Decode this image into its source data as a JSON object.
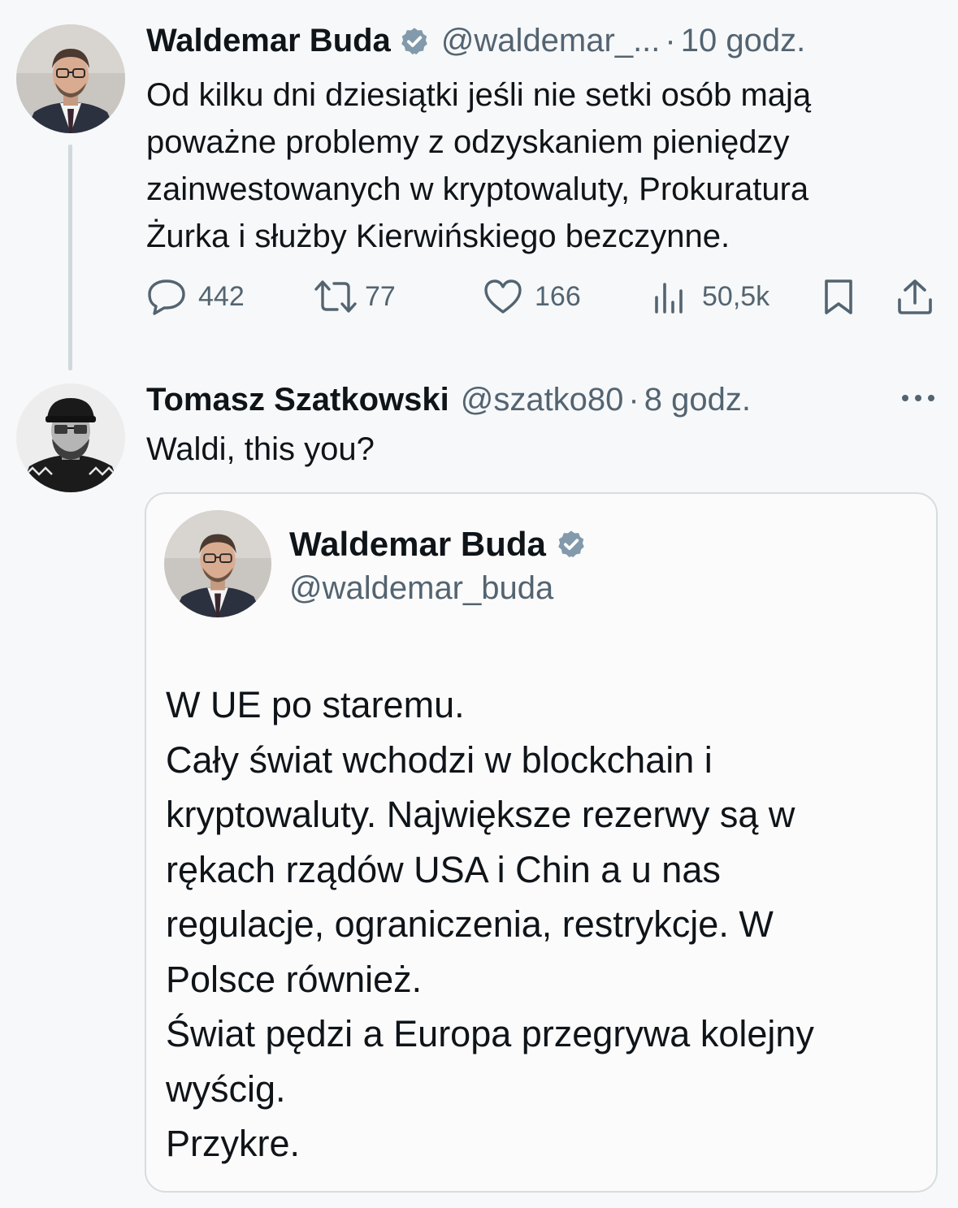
{
  "thread": {
    "original_tweet": {
      "author_name": "Waldemar Buda",
      "handle": "@waldemar_...",
      "separator": "·",
      "time": "10 godz.",
      "text": "Od kilku dni dziesiątki jeśli nie setki osób mają\npoważne problemy z odzyskaniem pieniędzy\nzainwestowanych w kryptowaluty, Prokuratura\nŻurka i służby Kierwińskiego bezczynne.",
      "icons": {
        "verified": "verified-badge-icon",
        "reply": "reply-icon",
        "retweet": "retweet-icon",
        "like": "heart-icon",
        "views": "views-icon",
        "bookmark": "bookmark-icon",
        "share": "share-icon"
      },
      "stats": {
        "replies": "442",
        "retweets": "77",
        "likes": "166",
        "views": "50,5k"
      }
    },
    "reply_tweet": {
      "author_name": "Tomasz Szatkowski",
      "handle": "@szatko80",
      "separator": "·",
      "time": "8 godz.",
      "text": "Waldi, this you?",
      "more_icon": "more-options-icon",
      "quoted_tweet": {
        "author_name": "Waldemar Buda",
        "handle": "@waldemar_buda",
        "text": "W UE po staremu.\nCały świat wchodzi w blockchain i\nkryptowaluty. Największe rezerwy są w\nrękach rządów USA i Chin a u nas\nregulacje, ograniczenia, restrykcje. W\nPolsce również.\nŚwiat pędzi a Europa przegrywa kolejny\nwyścig.\nPrzykre."
      }
    }
  },
  "colors": {
    "background": "#f7f8f9",
    "text_primary": "#0f1419",
    "text_secondary": "#536471",
    "thread_line": "#cfd9de",
    "verified_badge": "#829aab",
    "card_border": "#d6dde1"
  }
}
